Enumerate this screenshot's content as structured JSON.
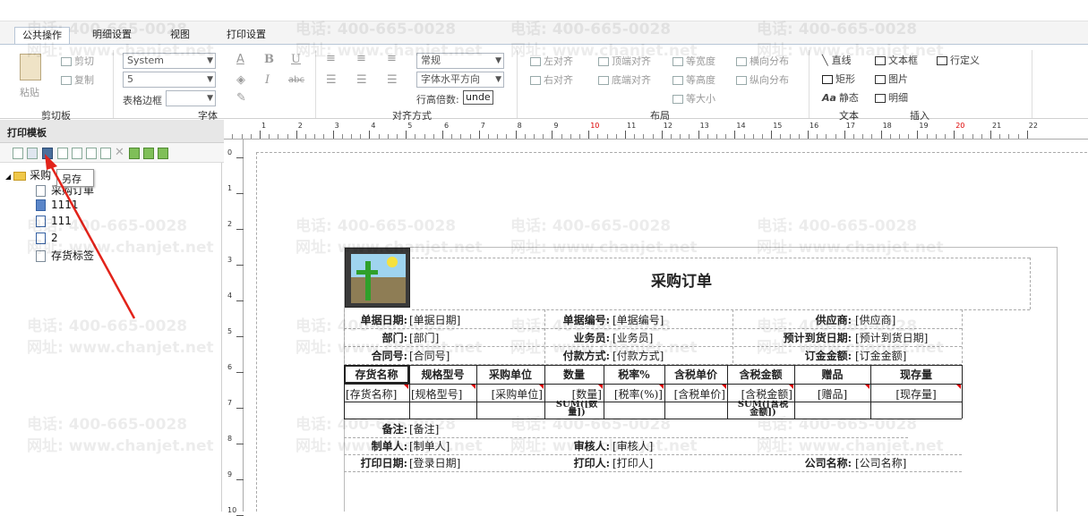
{
  "tabs": [
    "公共操作",
    "明细设置",
    "视图",
    "打印设置"
  ],
  "ribbon": {
    "clipboard": {
      "label": "剪切板",
      "paste": "粘贴",
      "cut": "剪切",
      "copy": "复制"
    },
    "font": {
      "label": "字体",
      "family": "System",
      "size": "5",
      "border_label": "表格边框"
    },
    "align": {
      "label": "对齐方式",
      "style": "常规",
      "halign": "字体水平方向",
      "line_height_label": "行高倍数:",
      "line_height_value": "unde"
    },
    "layout": {
      "label": "布局",
      "left": "左对齐",
      "top": "顶端对齐",
      "eq_width": "等宽度",
      "h_dist": "横向分布",
      "right": "右对齐",
      "bottom": "底端对齐",
      "eq_height": "等高度",
      "v_dist": "纵向分布",
      "eq_size": "等大小"
    },
    "text": {
      "label": "文本",
      "line": "直线",
      "rect": "矩形",
      "static": "静态"
    },
    "insert": {
      "label": "插入",
      "textbox": "文本框",
      "image": "图片",
      "detail": "明细",
      "custom": "行定义"
    }
  },
  "panel": {
    "title": "打印模板",
    "tooltip": "另存",
    "tree": {
      "root": "采购",
      "items": [
        "采购订单",
        "1111",
        "111",
        "2",
        "存货标签"
      ]
    }
  },
  "ruler_numbers": [
    "1",
    "2",
    "3",
    "4",
    "5",
    "6",
    "7",
    "8",
    "9",
    "10",
    "11",
    "12",
    "13",
    "14",
    "15",
    "16",
    "17",
    "18",
    "19",
    "20",
    "21",
    "22"
  ],
  "ruler_left_numbers": [
    "0",
    "1",
    "2",
    "3",
    "4",
    "5",
    "6",
    "7",
    "8",
    "9",
    "10"
  ],
  "watermark": {
    "phone": "电话: 400-665-0028",
    "site": "网址: www.chanjet.net"
  },
  "report": {
    "title": "采购订单",
    "rows": [
      [
        {
          "l": "单据日期:",
          "v": "[单据日期]"
        },
        {
          "l": "单据编号:",
          "v": "[单据编号]"
        },
        {
          "l": "供应商:",
          "v": "[供应商]"
        }
      ],
      [
        {
          "l": "部门:",
          "v": "[部门]"
        },
        {
          "l": "业务员:",
          "v": "[业务员]"
        },
        {
          "l": "预计到货日期:",
          "v": "[预计到货日期]"
        }
      ],
      [
        {
          "l": "合同号:",
          "v": "[合同号]"
        },
        {
          "l": "付款方式:",
          "v": "[付款方式]"
        },
        {
          "l": "订金金额:",
          "v": "[订金金额]"
        }
      ]
    ],
    "table_headers": [
      "存货名称",
      "规格型号",
      "采购单位",
      "数量",
      "税率%",
      "含税单价",
      "含税金额",
      "赠品",
      "现存量"
    ],
    "table_fields": [
      "[存货名称]",
      "[规格型号]",
      "[采购单位]",
      "[数量]",
      "[税率(%)]",
      "[含税单价]",
      "[含税金额]",
      "[赠品]",
      "[现存量]"
    ],
    "sum_qty": "SUM([数量])",
    "sum_amount": "SUM([含税金额])",
    "footer": [
      [
        {
          "l": "备注:",
          "v": "[备注]"
        }
      ],
      [
        {
          "l": "制单人:",
          "v": "[制单人]"
        },
        {
          "l": "审核人:",
          "v": "[审核人]"
        }
      ],
      [
        {
          "l": "打印日期:",
          "v": "[登录日期]"
        },
        {
          "l": "打印人:",
          "v": "[打印人]"
        },
        {
          "l": "公司名称:",
          "v": "[公司名称]"
        }
      ]
    ]
  }
}
